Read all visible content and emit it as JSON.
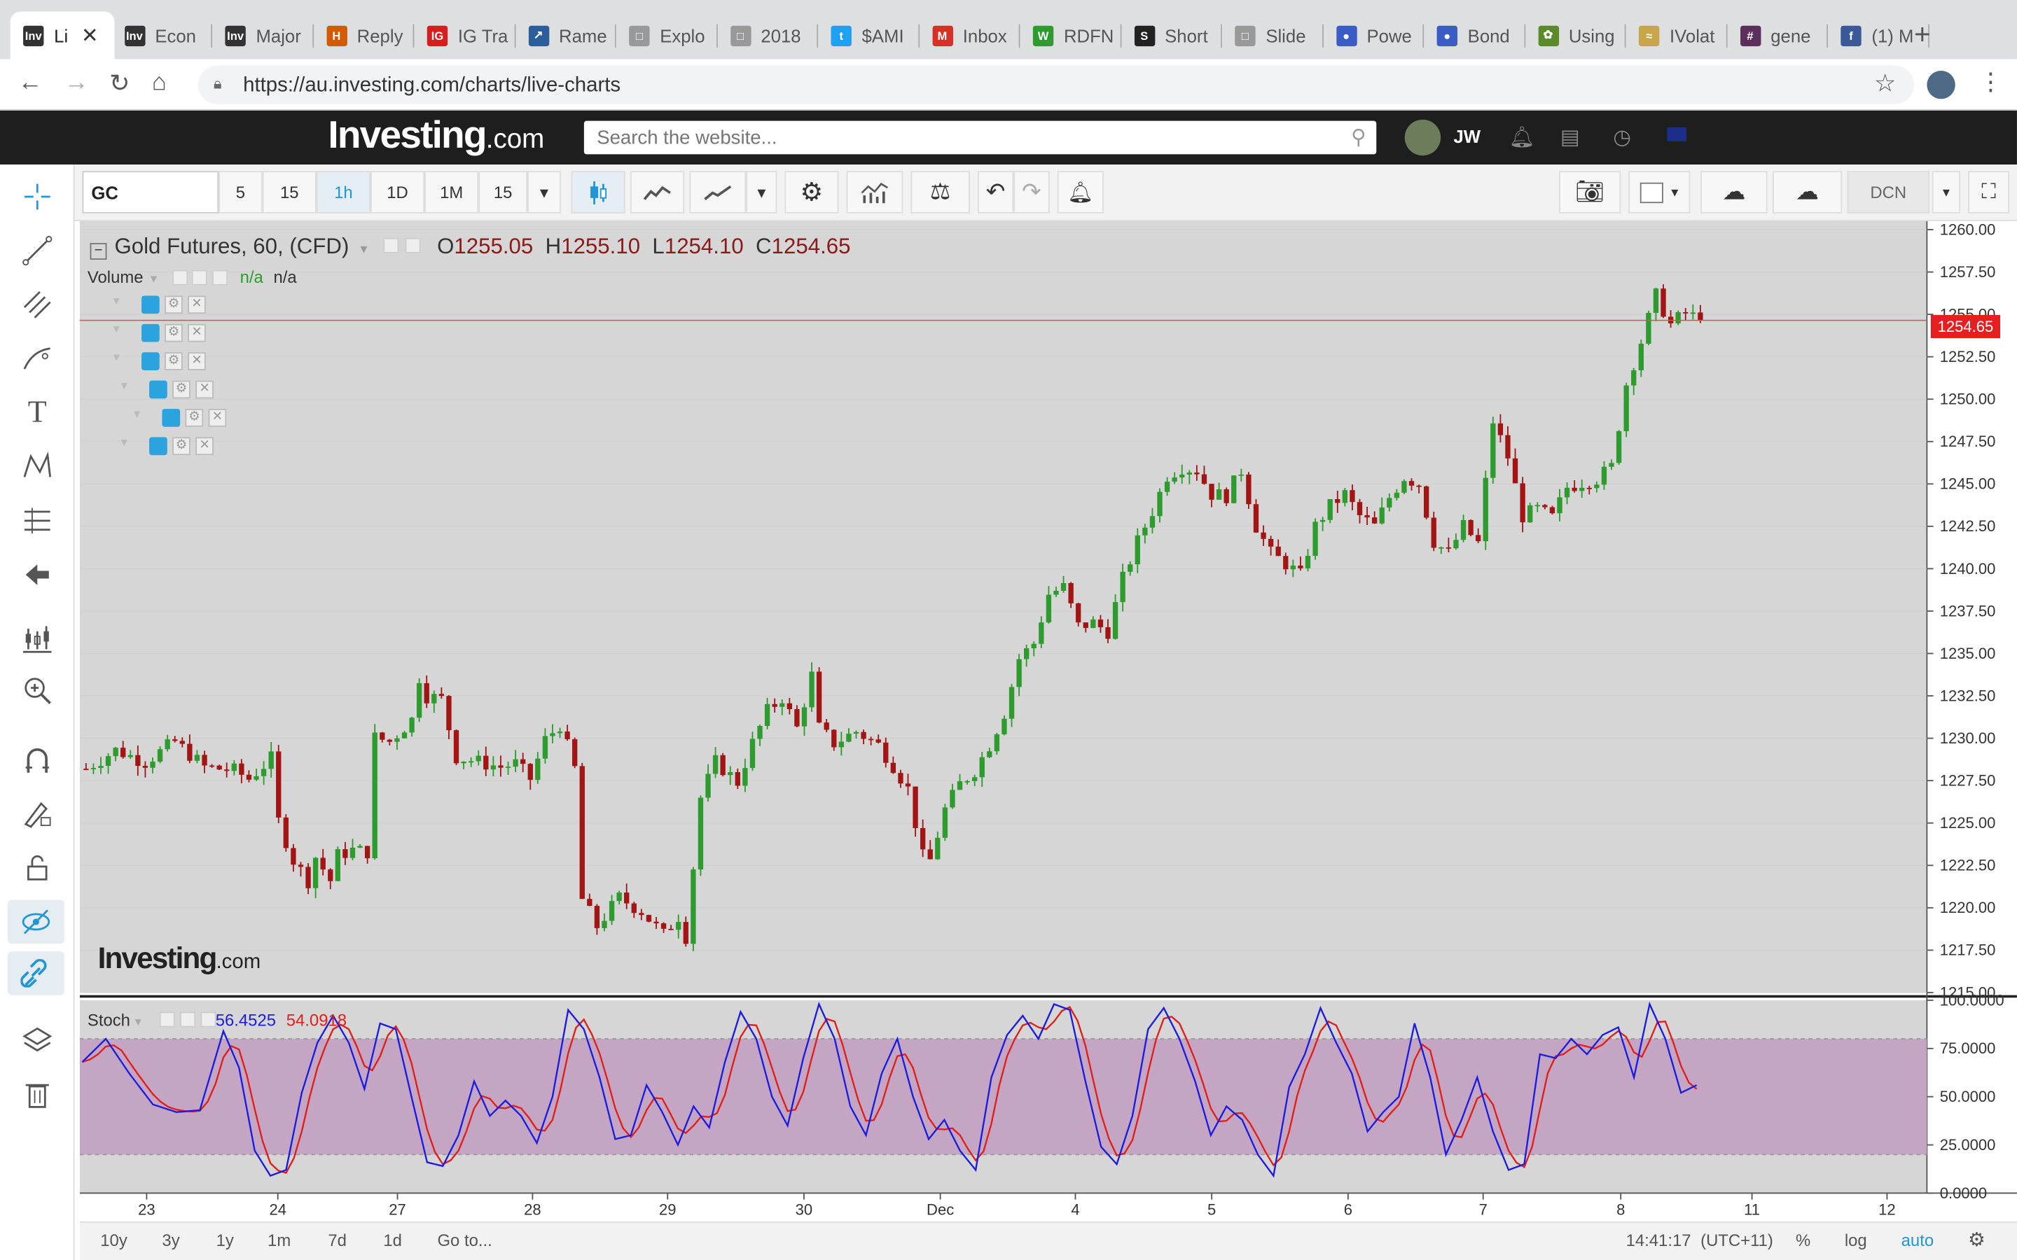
{
  "browser": {
    "tabs": [
      {
        "title": "Li",
        "fav": "Inv",
        "favcolor": "#333333",
        "active": true
      },
      {
        "title": "Econ",
        "fav": "Inv",
        "favcolor": "#333333"
      },
      {
        "title": "Major",
        "fav": "Inv",
        "favcolor": "#333333"
      },
      {
        "title": "Reply",
        "fav": "H",
        "favcolor": "#d45a00"
      },
      {
        "title": "IG Tra",
        "fav": "IG",
        "favcolor": "#d61e1e"
      },
      {
        "title": "Rame",
        "fav": "↗",
        "favcolor": "#2b5e9a"
      },
      {
        "title": "Explo",
        "fav": "□",
        "favcolor": "#999999"
      },
      {
        "title": "2018",
        "fav": "□",
        "favcolor": "#999999"
      },
      {
        "title": "$AMI",
        "fav": "t",
        "favcolor": "#1da1f2"
      },
      {
        "title": "Inbox",
        "fav": "M",
        "favcolor": "#d93025"
      },
      {
        "title": "RDFN",
        "fav": "W",
        "favcolor": "#2e9b2e"
      },
      {
        "title": "Short",
        "fav": "S",
        "favcolor": "#222222"
      },
      {
        "title": "Slide",
        "fav": "□",
        "favcolor": "#999999"
      },
      {
        "title": "Powe",
        "fav": "●",
        "favcolor": "#3b5cc4"
      },
      {
        "title": "Bond",
        "fav": "●",
        "favcolor": "#3b5cc4"
      },
      {
        "title": "Using",
        "fav": "✿",
        "favcolor": "#5a8a2a"
      },
      {
        "title": "IVolat",
        "fav": "≈",
        "favcolor": "#c9a54a"
      },
      {
        "title": "gene",
        "fav": "#",
        "favcolor": "#5b2e5b"
      },
      {
        "title": "(1) M",
        "fav": "f",
        "favcolor": "#3b5998"
      }
    ],
    "url": "https://au.investing.com/charts/live-charts"
  },
  "site": {
    "logo": "Investing",
    "logo_suffix": ".com",
    "search_placeholder": "Search the website...",
    "user": "JW"
  },
  "toolbar": {
    "symbol": "GC",
    "intervals": [
      "5",
      "15",
      "1h",
      "1D",
      "1M",
      "15"
    ],
    "selected_interval": "1h",
    "layout": "DCN"
  },
  "legend": {
    "title": "Gold Futures, 60, (CFD)",
    "o_label": "O",
    "o": "1255.05",
    "h_label": "H",
    "h": "1255.10",
    "l_label": "L",
    "l": "1254.10",
    "c_label": "C",
    "c": "1254.65",
    "volume_label": "Volume",
    "volume_v1": "n/a",
    "volume_v2": "n/a"
  },
  "stoch": {
    "label": "Stoch",
    "k": "56.4525",
    "d": "54.0918",
    "k_color": "#1d1de0",
    "d_color": "#e0201a",
    "band_color": "#c4a6c4"
  },
  "watermark": {
    "main": "Investing",
    "suffix": ".com"
  },
  "chart_data": {
    "type": "candlestick",
    "y_axis_ticks": [
      "1260.00",
      "1257.50",
      "1255.00",
      "1252.50",
      "1250.00",
      "1247.50",
      "1245.00",
      "1242.50",
      "1240.00",
      "1237.50",
      "1235.00",
      "1232.50",
      "1230.00",
      "1227.50",
      "1225.00",
      "1222.50",
      "1220.00",
      "1217.50",
      "1215.00"
    ],
    "ylim": [
      1215,
      1260.5
    ],
    "last_price": "1254.65",
    "last_price_value": 1254.65,
    "up_color": "#2e9b2e",
    "down_color": "#a31515",
    "x_labels": [
      "23",
      "24",
      "27",
      "28",
      "29",
      "30",
      "Dec",
      "4",
      "5",
      "6",
      "7",
      "8",
      "11",
      "12"
    ],
    "stoch_ticks": [
      "100.0000",
      "75.0000",
      "50.0000",
      "25.0000",
      "0.0000"
    ],
    "stoch_band": [
      20,
      80
    ],
    "price_path": [
      [
        0,
        1228.2
      ],
      [
        4,
        1229.3
      ],
      [
        8,
        1228.6
      ],
      [
        12,
        1229.8
      ],
      [
        16,
        1228.3
      ],
      [
        20,
        1228.1
      ],
      [
        22,
        1227.6
      ],
      [
        25,
        1228.8
      ],
      [
        26,
        1225.1
      ],
      [
        28,
        1222.8
      ],
      [
        30,
        1221.6
      ],
      [
        31,
        1223.0
      ],
      [
        33,
        1221.6
      ],
      [
        34,
        1223.1
      ],
      [
        36,
        1223.4
      ],
      [
        38,
        1223.3
      ],
      [
        38.5,
        1230.1
      ],
      [
        41,
        1229.8
      ],
      [
        44,
        1231.1
      ],
      [
        45,
        1233.6
      ],
      [
        46,
        1232.5
      ],
      [
        48,
        1232.3
      ],
      [
        50,
        1228.9
      ],
      [
        53,
        1228.6
      ],
      [
        56,
        1228.3
      ],
      [
        58,
        1228.5
      ],
      [
        60,
        1227.6
      ],
      [
        62,
        1229.9
      ],
      [
        64,
        1230.8
      ],
      [
        66,
        1228.2
      ],
      [
        67,
        1220.5
      ],
      [
        69,
        1218.9
      ],
      [
        72,
        1220.6
      ],
      [
        75,
        1219.8
      ],
      [
        78,
        1218.4
      ],
      [
        80,
        1219.5
      ],
      [
        81,
        1218.3
      ],
      [
        83,
        1226.5
      ],
      [
        85,
        1228.6
      ],
      [
        88,
        1227.4
      ],
      [
        90,
        1229.7
      ],
      [
        92,
        1231.6
      ],
      [
        94,
        1232.4
      ],
      [
        96,
        1230.6
      ],
      [
        98,
        1233.7
      ],
      [
        99,
        1230.6
      ],
      [
        101,
        1229.7
      ],
      [
        104,
        1230.4
      ],
      [
        107,
        1229.6
      ],
      [
        109,
        1228.4
      ],
      [
        111,
        1227.0
      ],
      [
        113,
        1223.0
      ],
      [
        114,
        1222.8
      ],
      [
        116,
        1225.8
      ],
      [
        118,
        1227.3
      ],
      [
        120,
        1228.1
      ],
      [
        122,
        1229.6
      ],
      [
        124,
        1231.5
      ],
      [
        126,
        1234.7
      ],
      [
        128,
        1235.6
      ],
      [
        130,
        1238.5
      ],
      [
        132,
        1238.9
      ],
      [
        134,
        1236.6
      ],
      [
        136,
        1236.8
      ],
      [
        138,
        1236.3
      ],
      [
        140,
        1239.4
      ],
      [
        142,
        1241.6
      ],
      [
        144,
        1243.4
      ],
      [
        146,
        1245.5
      ],
      [
        148,
        1246.0
      ],
      [
        150,
        1245.8
      ],
      [
        152,
        1244.4
      ],
      [
        154,
        1244.3
      ],
      [
        156,
        1245.8
      ],
      [
        158,
        1242.5
      ],
      [
        160,
        1240.9
      ],
      [
        162,
        1240.3
      ],
      [
        164,
        1239.6
      ],
      [
        166,
        1242.5
      ],
      [
        168,
        1243.7
      ],
      [
        170,
        1244.4
      ],
      [
        172,
        1243.1
      ],
      [
        174,
        1242.5
      ],
      [
        176,
        1244.2
      ],
      [
        178,
        1245.4
      ],
      [
        180,
        1245.0
      ],
      [
        182,
        1241.6
      ],
      [
        184,
        1240.9
      ],
      [
        186,
        1242.5
      ],
      [
        188,
        1241.5
      ],
      [
        190,
        1248.7
      ],
      [
        192,
        1246.6
      ],
      [
        194,
        1243.1
      ],
      [
        196,
        1243.5
      ],
      [
        198,
        1243.0
      ],
      [
        200,
        1244.8
      ],
      [
        202,
        1245.1
      ],
      [
        204,
        1245.3
      ],
      [
        206,
        1246.0
      ],
      [
        208,
        1250.9
      ],
      [
        210,
        1253.4
      ],
      [
        212,
        1256.1
      ],
      [
        214,
        1254.4
      ],
      [
        216,
        1255.1
      ],
      [
        218,
        1254.65
      ]
    ],
    "stoch_k_path": [
      [
        0,
        68
      ],
      [
        3,
        80
      ],
      [
        6,
        62
      ],
      [
        9,
        46
      ],
      [
        12,
        42
      ],
      [
        15,
        43
      ],
      [
        18,
        84
      ],
      [
        20,
        65
      ],
      [
        22,
        22
      ],
      [
        24,
        9
      ],
      [
        26,
        12
      ],
      [
        28,
        52
      ],
      [
        30,
        78
      ],
      [
        32,
        92
      ],
      [
        34,
        78
      ],
      [
        36,
        54
      ],
      [
        38,
        88
      ],
      [
        40,
        85
      ],
      [
        42,
        50
      ],
      [
        44,
        16
      ],
      [
        46,
        14
      ],
      [
        48,
        30
      ],
      [
        50,
        58
      ],
      [
        52,
        40
      ],
      [
        54,
        48
      ],
      [
        56,
        40
      ],
      [
        58,
        26
      ],
      [
        60,
        50
      ],
      [
        62,
        95
      ],
      [
        64,
        85
      ],
      [
        66,
        60
      ],
      [
        68,
        28
      ],
      [
        70,
        30
      ],
      [
        72,
        56
      ],
      [
        74,
        42
      ],
      [
        76,
        25
      ],
      [
        78,
        45
      ],
      [
        80,
        34
      ],
      [
        82,
        68
      ],
      [
        84,
        94
      ],
      [
        86,
        80
      ],
      [
        88,
        50
      ],
      [
        90,
        35
      ],
      [
        92,
        70
      ],
      [
        94,
        98
      ],
      [
        96,
        80
      ],
      [
        98,
        45
      ],
      [
        100,
        30
      ],
      [
        102,
        62
      ],
      [
        104,
        80
      ],
      [
        106,
        50
      ],
      [
        108,
        28
      ],
      [
        110,
        38
      ],
      [
        112,
        22
      ],
      [
        114,
        12
      ],
      [
        116,
        60
      ],
      [
        118,
        82
      ],
      [
        120,
        92
      ],
      [
        122,
        80
      ],
      [
        124,
        98
      ],
      [
        126,
        95
      ],
      [
        128,
        58
      ],
      [
        130,
        24
      ],
      [
        132,
        15
      ],
      [
        134,
        40
      ],
      [
        136,
        85
      ],
      [
        138,
        96
      ],
      [
        140,
        80
      ],
      [
        142,
        58
      ],
      [
        144,
        30
      ],
      [
        146,
        45
      ],
      [
        148,
        38
      ],
      [
        150,
        20
      ],
      [
        152,
        9
      ],
      [
        154,
        55
      ],
      [
        156,
        72
      ],
      [
        158,
        96
      ],
      [
        160,
        78
      ],
      [
        162,
        62
      ],
      [
        164,
        32
      ],
      [
        166,
        42
      ],
      [
        168,
        50
      ],
      [
        170,
        88
      ],
      [
        172,
        60
      ],
      [
        174,
        20
      ],
      [
        176,
        38
      ],
      [
        178,
        60
      ],
      [
        180,
        32
      ],
      [
        182,
        12
      ],
      [
        184,
        15
      ],
      [
        186,
        72
      ],
      [
        188,
        70
      ],
      [
        190,
        80
      ],
      [
        192,
        72
      ],
      [
        194,
        82
      ],
      [
        196,
        86
      ],
      [
        198,
        60
      ],
      [
        200,
        98
      ],
      [
        202,
        80
      ],
      [
        204,
        52
      ],
      [
        206,
        56
      ]
    ]
  },
  "bottom": {
    "ranges": [
      "10y",
      "3y",
      "1y",
      "1m",
      "7d",
      "1d"
    ],
    "goto": "Go to...",
    "time": "14:41:17",
    "tz": "(UTC+11)",
    "pct": "%",
    "log": "log",
    "auto": "auto"
  }
}
